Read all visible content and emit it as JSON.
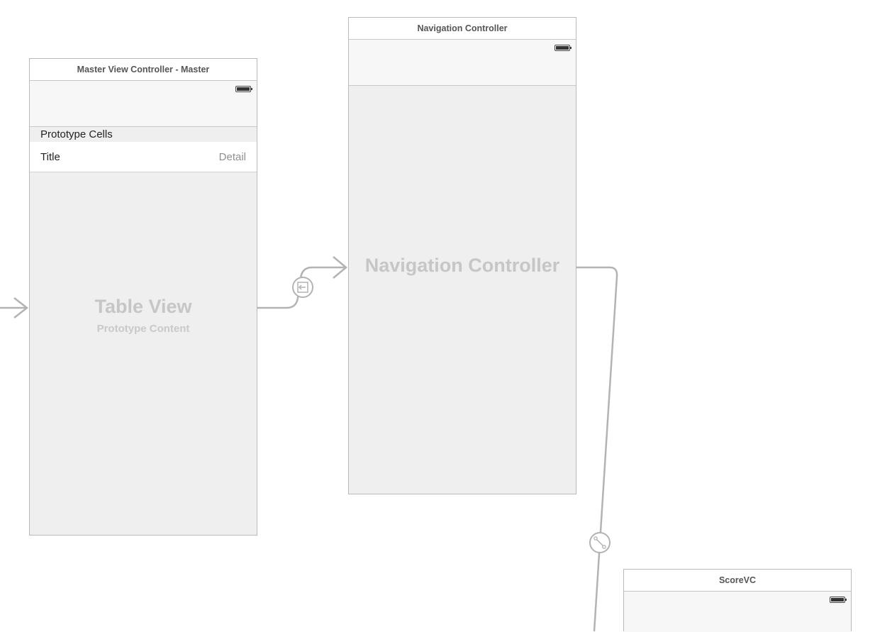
{
  "scenes": {
    "master": {
      "title": "Master View Controller - Master",
      "section_header": "Prototype Cells",
      "cell_title": "Title",
      "cell_detail": "Detail",
      "placeholder_title": "Table View",
      "placeholder_subtitle": "Prototype Content"
    },
    "navigation": {
      "title": "Navigation Controller",
      "placeholder_title": "Navigation Controller"
    },
    "score": {
      "title": "ScoreVC"
    }
  },
  "segues": [
    {
      "icon": "push-segue-icon"
    },
    {
      "icon": "embed-segue-icon"
    }
  ],
  "colors": {
    "segue_line": "#b3b3b3",
    "scene_background": "#efefef",
    "placeholder_text": "#c6c6c6"
  }
}
